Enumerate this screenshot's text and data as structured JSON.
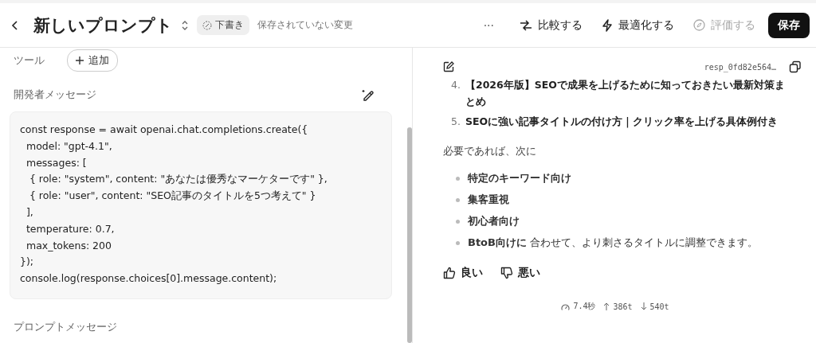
{
  "header": {
    "title": "新しいプロンプト",
    "badge": "下書き",
    "status": "保存されていない変更",
    "more": "···",
    "actions": [
      {
        "kind": "compare",
        "label": "比較する",
        "disabled": false
      },
      {
        "kind": "optimize",
        "label": "最適化する",
        "disabled": false
      },
      {
        "kind": "evaluate",
        "label": "評価する",
        "disabled": true
      }
    ],
    "save": "保存"
  },
  "left": {
    "tools_label": "ツール",
    "add_button": "追加",
    "developer_label": "開発者メッセージ",
    "code": "const response = await openai.chat.completions.create({\n  model: \"gpt-4.1\",\n  messages: [\n   { role: \"system\", content: \"あなたは優秀なマーケターです\" },\n   { role: \"user\", content: \"SEO記事のタイトルを5つ考えて\" }\n  ],\n  temperature: 0.7,\n  max_tokens: 200\n});\nconsole.log(response.choices[0].message.content);",
    "prompt_label": "プロンプトメッセージ"
  },
  "right": {
    "response_id": "resp_0fd82e564…",
    "numbered": [
      {
        "number": "4.",
        "text": "【2026年版】SEOで成果を上げるために知っておきたい最新対策まとめ"
      },
      {
        "number": "5.",
        "text": "SEOに強い記事タイトルの付け方｜クリック率を上げる具体例付き"
      }
    ],
    "intro": "必要であれば、次に",
    "bullets": [
      "**特定のキーワード向け**",
      "**集客重視**",
      "**初心者向け**",
      "**BtoB向けに** 合わせて、より刺さるタイトルに調整できます。"
    ],
    "feedback": [
      "良い",
      "悪い"
    ],
    "stats": {
      "time": "7.4秒",
      "tokens_in": "386t",
      "tokens_out": "540t"
    }
  }
}
